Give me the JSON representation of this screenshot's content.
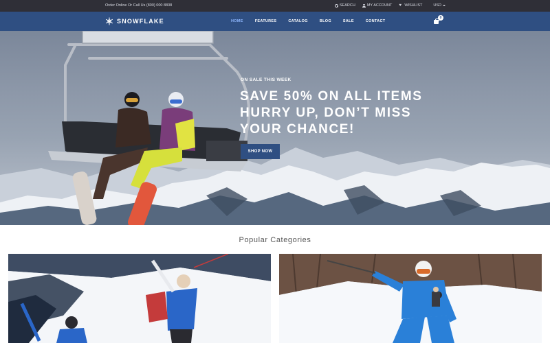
{
  "topbar": {
    "phone_text": "Order Online Or Call Us (800) 000 8808",
    "search_label": "SEARCH",
    "account_label": "MY ACCOUNT",
    "wishlist_label": "WISHLIST",
    "currency_label": "USD"
  },
  "nav": {
    "logo_text": "SNOWFLAKE",
    "items": [
      "HOME",
      "FEATURES",
      "CATALOG",
      "BLOG",
      "SALE",
      "CONTACT"
    ],
    "active_item": "HOME",
    "cart_count": "0"
  },
  "hero": {
    "eyebrow": "ON SALE THIS WEEK",
    "headline_line1": "SAVE 50% ON ALL ITEMS",
    "headline_line2": "HURRY UP, DON’T MISS",
    "headline_line3": "YOUR CHANCE!",
    "cta_label": "SHOP NOW"
  },
  "categories": {
    "title": "Popular Categories"
  },
  "colors": {
    "topbar_bg": "#2f2f37",
    "nav_bg": "#2f4f82",
    "accent": "#2f4f82",
    "active_link": "#8fb7ff"
  },
  "icons": [
    "search-icon",
    "user-icon",
    "heart-icon",
    "snowflake-logo-icon",
    "cart-icon",
    "chevron-down-icon"
  ]
}
